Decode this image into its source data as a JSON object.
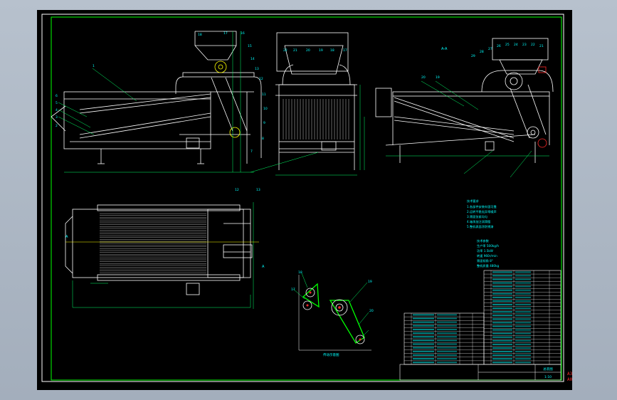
{
  "drawing": {
    "section_label": "A-A",
    "callouts_front": [
      "18",
      "17",
      "16",
      "15",
      "14",
      "13",
      "12",
      "11",
      "10",
      "9",
      "8",
      "7",
      "6",
      "5",
      "4",
      "3",
      "2",
      "1"
    ],
    "callouts_side": [
      "22",
      "21",
      "20",
      "19",
      "18",
      "17"
    ],
    "callouts_section": [
      "29",
      "28",
      "27",
      "26",
      "25",
      "24",
      "23",
      "22",
      "21",
      "20",
      "19"
    ],
    "callouts_belt": [
      "17",
      "18",
      "19",
      "20"
    ],
    "belt_view_label": "传动示意图",
    "section_marker": "A",
    "notes": {
      "title": "技术要求",
      "lines": [
        "1.各部件安装牢固可靠",
        "2.运转平稳无异常噪声",
        "3.筛面张紧均匀",
        "4.轴承加注润滑脂",
        "5.整机表面涂防锈漆"
      ]
    },
    "specs": {
      "title": "技术参数",
      "lines": [
        "生产率 500kg/h",
        "功率 1.5kW",
        "转速 960r/min",
        "筛面倾角 8°",
        "整机质量 480kg"
      ]
    },
    "title_block": {
      "drawing_name": "总装图",
      "scale": "1:10"
    }
  },
  "revision_mark": "A3\nA0",
  "colors": {
    "line": "#ffffff",
    "dim": "#00ff66",
    "text": "#00ffff",
    "frame": "#00ff00",
    "belt": "#00ff00",
    "red": "#ff2a2a",
    "yellow": "#ffff00"
  }
}
